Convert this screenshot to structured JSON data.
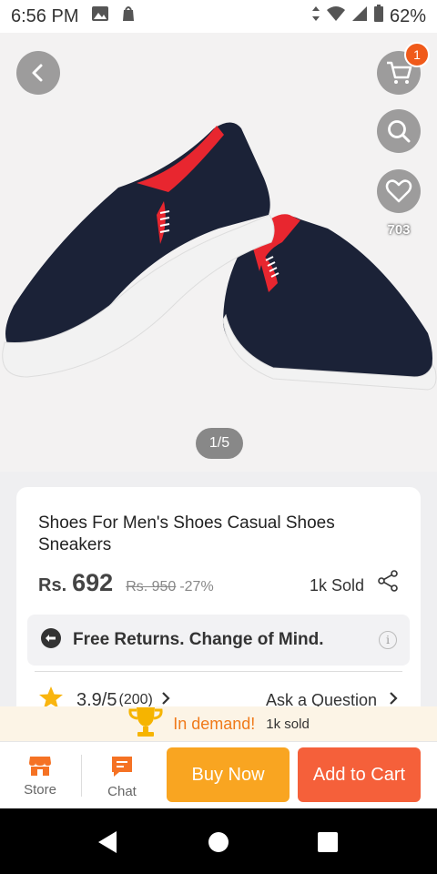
{
  "status_bar": {
    "time": "6:56 PM",
    "battery": "62%"
  },
  "hero": {
    "favorites_count": "703",
    "cart_badge": "1",
    "image_index": "1/5"
  },
  "product": {
    "title": "Shoes For Men's Shoes Casual Shoes Sneakers",
    "currency": "Rs.",
    "price": "692",
    "original_price": "Rs. 950",
    "discount": "-27%",
    "sold": "1k Sold"
  },
  "returns": {
    "text": "Free Returns. Change of Mind."
  },
  "rating": {
    "score": "3.9/5",
    "count": "(200)",
    "ask_question": "Ask a Question"
  },
  "demand": {
    "label": "In demand!",
    "sold": "1k sold"
  },
  "bottom_bar": {
    "store": "Store",
    "chat": "Chat",
    "buy_now": "Buy Now",
    "add_to_cart": "Add to Cart"
  },
  "colors": {
    "accent_orange": "#f57224",
    "buy_now": "#f9a521",
    "add_to_cart": "#f5603a"
  }
}
